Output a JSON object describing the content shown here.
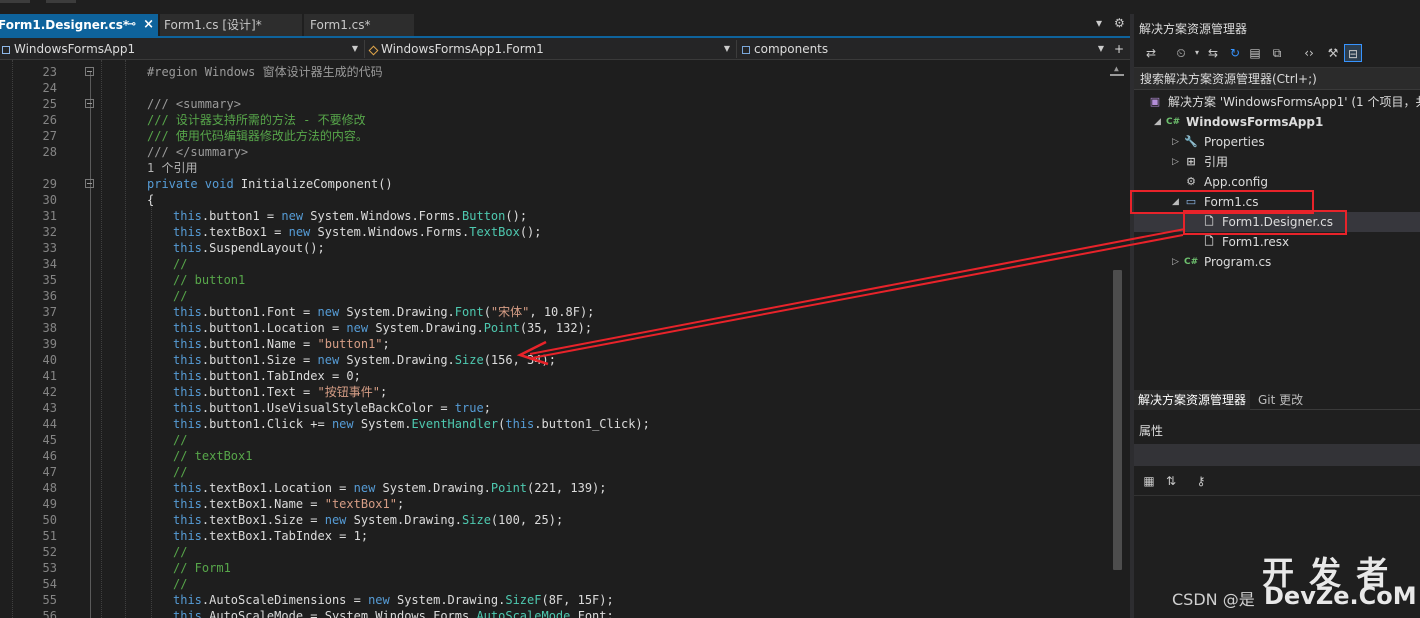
{
  "tabs": [
    {
      "label": "Form1.Designer.cs*",
      "pin": "⊸",
      "close": "×"
    },
    {
      "label": "Form1.cs [设计]*"
    },
    {
      "label": "Form1.cs*"
    }
  ],
  "tab_tools": {
    "overflow": "▾",
    "settings": "⚙"
  },
  "navbar": {
    "project": "WindowsFormsApp1",
    "class": "WindowsFormsApp1.Form1",
    "member": "components"
  },
  "code_lines": [
    {
      "n": "23",
      "fold": true,
      "indent": 0,
      "parts": [
        {
          "c": "g",
          "t": "#region Windows 窗体设计器生成的代码"
        }
      ]
    },
    {
      "n": "24",
      "indent": 0,
      "parts": []
    },
    {
      "n": "25",
      "fold": true,
      "indent": 0,
      "parts": [
        {
          "c": "g",
          "t": "/// <summary>"
        }
      ]
    },
    {
      "n": "26",
      "indent": 0,
      "parts": [
        {
          "c": "cm",
          "t": "/// 设计器支持所需的方法 - 不要修改"
        }
      ]
    },
    {
      "n": "27",
      "indent": 0,
      "parts": [
        {
          "c": "cm",
          "t": "/// 使用代码编辑器修改此方法的内容。"
        }
      ]
    },
    {
      "n": "28",
      "indent": 0,
      "parts": [
        {
          "c": "g",
          "t": "/// </summary>"
        }
      ]
    },
    {
      "n": "",
      "indent": 0,
      "parts": [
        {
          "c": "cr",
          "t": "1 个引用"
        }
      ]
    },
    {
      "n": "29",
      "fold": true,
      "indent": 0,
      "parts": [
        {
          "c": "k",
          "t": "private void "
        },
        {
          "c": "",
          "t": "InitializeComponent()"
        }
      ]
    },
    {
      "n": "30",
      "indent": 0,
      "parts": [
        {
          "c": "",
          "t": "{"
        }
      ]
    },
    {
      "n": "31",
      "indent": 1,
      "parts": [
        {
          "c": "k",
          "t": "this"
        },
        {
          "c": "",
          "t": ".button1 = "
        },
        {
          "c": "k",
          "t": "new "
        },
        {
          "c": "",
          "t": "System.Windows.Forms."
        },
        {
          "c": "t",
          "t": "Button"
        },
        {
          "c": "",
          "t": "();"
        }
      ]
    },
    {
      "n": "32",
      "indent": 1,
      "parts": [
        {
          "c": "k",
          "t": "this"
        },
        {
          "c": "",
          "t": ".textBox1 = "
        },
        {
          "c": "k",
          "t": "new "
        },
        {
          "c": "",
          "t": "System.Windows.Forms."
        },
        {
          "c": "t",
          "t": "TextBox"
        },
        {
          "c": "",
          "t": "();"
        }
      ]
    },
    {
      "n": "33",
      "indent": 1,
      "parts": [
        {
          "c": "k",
          "t": "this"
        },
        {
          "c": "",
          "t": ".SuspendLayout();"
        }
      ]
    },
    {
      "n": "34",
      "indent": 1,
      "parts": [
        {
          "c": "cm",
          "t": "//"
        }
      ]
    },
    {
      "n": "35",
      "indent": 1,
      "parts": [
        {
          "c": "cm",
          "t": "// button1"
        }
      ]
    },
    {
      "n": "36",
      "indent": 1,
      "parts": [
        {
          "c": "cm",
          "t": "//"
        }
      ]
    },
    {
      "n": "37",
      "indent": 1,
      "parts": [
        {
          "c": "k",
          "t": "this"
        },
        {
          "c": "",
          "t": ".button1.Font = "
        },
        {
          "c": "k",
          "t": "new "
        },
        {
          "c": "",
          "t": "System.Drawing."
        },
        {
          "c": "t",
          "t": "Font"
        },
        {
          "c": "",
          "t": "("
        },
        {
          "c": "s",
          "t": "\"宋体\""
        },
        {
          "c": "",
          "t": ", 10.8F);"
        }
      ]
    },
    {
      "n": "38",
      "indent": 1,
      "parts": [
        {
          "c": "k",
          "t": "this"
        },
        {
          "c": "",
          "t": ".button1.Location = "
        },
        {
          "c": "k",
          "t": "new "
        },
        {
          "c": "",
          "t": "System.Drawing."
        },
        {
          "c": "t",
          "t": "Point"
        },
        {
          "c": "",
          "t": "(35, 132);"
        }
      ]
    },
    {
      "n": "39",
      "indent": 1,
      "parts": [
        {
          "c": "k",
          "t": "this"
        },
        {
          "c": "",
          "t": ".button1.Name = "
        },
        {
          "c": "s",
          "t": "\"button1\""
        },
        {
          "c": "",
          "t": ";"
        }
      ]
    },
    {
      "n": "40",
      "indent": 1,
      "parts": [
        {
          "c": "k",
          "t": "this"
        },
        {
          "c": "",
          "t": ".button1.Size = "
        },
        {
          "c": "k",
          "t": "new "
        },
        {
          "c": "",
          "t": "System.Drawing."
        },
        {
          "c": "t",
          "t": "Size"
        },
        {
          "c": "",
          "t": "(156, 34);"
        }
      ]
    },
    {
      "n": "41",
      "indent": 1,
      "parts": [
        {
          "c": "k",
          "t": "this"
        },
        {
          "c": "",
          "t": ".button1.TabIndex = 0;"
        }
      ]
    },
    {
      "n": "42",
      "indent": 1,
      "parts": [
        {
          "c": "k",
          "t": "this"
        },
        {
          "c": "",
          "t": ".button1.Text = "
        },
        {
          "c": "s",
          "t": "\"按钮事件\""
        },
        {
          "c": "",
          "t": ";"
        }
      ]
    },
    {
      "n": "43",
      "indent": 1,
      "parts": [
        {
          "c": "k",
          "t": "this"
        },
        {
          "c": "",
          "t": ".button1.UseVisualStyleBackColor = "
        },
        {
          "c": "k",
          "t": "true"
        },
        {
          "c": "",
          "t": ";"
        }
      ]
    },
    {
      "n": "44",
      "indent": 1,
      "parts": [
        {
          "c": "k",
          "t": "this"
        },
        {
          "c": "",
          "t": ".button1.Click += "
        },
        {
          "c": "k",
          "t": "new "
        },
        {
          "c": "",
          "t": "System."
        },
        {
          "c": "t",
          "t": "EventHandler"
        },
        {
          "c": "",
          "t": "("
        },
        {
          "c": "k",
          "t": "this"
        },
        {
          "c": "",
          "t": ".button1_Click);"
        }
      ]
    },
    {
      "n": "45",
      "indent": 1,
      "parts": [
        {
          "c": "cm",
          "t": "//"
        }
      ]
    },
    {
      "n": "46",
      "indent": 1,
      "parts": [
        {
          "c": "cm",
          "t": "// textBox1"
        }
      ]
    },
    {
      "n": "47",
      "indent": 1,
      "parts": [
        {
          "c": "cm",
          "t": "//"
        }
      ]
    },
    {
      "n": "48",
      "indent": 1,
      "parts": [
        {
          "c": "k",
          "t": "this"
        },
        {
          "c": "",
          "t": ".textBox1.Location = "
        },
        {
          "c": "k",
          "t": "new "
        },
        {
          "c": "",
          "t": "System.Drawing."
        },
        {
          "c": "t",
          "t": "Point"
        },
        {
          "c": "",
          "t": "(221, 139);"
        }
      ]
    },
    {
      "n": "49",
      "indent": 1,
      "parts": [
        {
          "c": "k",
          "t": "this"
        },
        {
          "c": "",
          "t": ".textBox1.Name = "
        },
        {
          "c": "s",
          "t": "\"textBox1\""
        },
        {
          "c": "",
          "t": ";"
        }
      ]
    },
    {
      "n": "50",
      "indent": 1,
      "parts": [
        {
          "c": "k",
          "t": "this"
        },
        {
          "c": "",
          "t": ".textBox1.Size = "
        },
        {
          "c": "k",
          "t": "new "
        },
        {
          "c": "",
          "t": "System.Drawing."
        },
        {
          "c": "t",
          "t": "Size"
        },
        {
          "c": "",
          "t": "(100, 25);"
        }
      ]
    },
    {
      "n": "51",
      "indent": 1,
      "parts": [
        {
          "c": "k",
          "t": "this"
        },
        {
          "c": "",
          "t": ".textBox1.TabIndex = 1;"
        }
      ]
    },
    {
      "n": "52",
      "indent": 1,
      "parts": [
        {
          "c": "cm",
          "t": "//"
        }
      ]
    },
    {
      "n": "53",
      "indent": 1,
      "parts": [
        {
          "c": "cm",
          "t": "// Form1"
        }
      ]
    },
    {
      "n": "54",
      "indent": 1,
      "parts": [
        {
          "c": "cm",
          "t": "//"
        }
      ]
    },
    {
      "n": "55",
      "indent": 1,
      "parts": [
        {
          "c": "k",
          "t": "this"
        },
        {
          "c": "",
          "t": ".AutoScaleDimensions = "
        },
        {
          "c": "k",
          "t": "new "
        },
        {
          "c": "",
          "t": "System.Drawing."
        },
        {
          "c": "t",
          "t": "SizeF"
        },
        {
          "c": "",
          "t": "(8F, 15F);"
        }
      ]
    },
    {
      "n": "56",
      "indent": 1,
      "parts": [
        {
          "c": "k",
          "t": "this"
        },
        {
          "c": "",
          "t": ".AutoScaleMode = System.Windows.Forms."
        },
        {
          "c": "t",
          "t": "AutoScaleMode"
        },
        {
          "c": "",
          "t": ".Font;"
        }
      ]
    }
  ],
  "solution_explorer": {
    "title": "解决方案资源管理器",
    "search_placeholder": "搜索解决方案资源管理器(Ctrl+;)",
    "tree": [
      {
        "label": "解决方案 'WindowsFormsApp1' (1 个项目，共",
        "icon": "solution-icon",
        "depth": 0,
        "expander": "",
        "bold": false
      },
      {
        "label": "WindowsFormsApp1",
        "icon": "csharp-project-icon",
        "depth": 1,
        "expander": "◢",
        "bold": true
      },
      {
        "label": "Properties",
        "icon": "wrench-icon",
        "depth": 2,
        "expander": "▷",
        "bold": false
      },
      {
        "label": "引用",
        "icon": "references-icon",
        "depth": 2,
        "expander": "▷",
        "bold": false
      },
      {
        "label": "App.config",
        "icon": "config-file-icon",
        "depth": 2,
        "expander": "",
        "bold": false
      },
      {
        "label": "Form1.cs",
        "icon": "form-icon",
        "depth": 2,
        "expander": "◢",
        "bold": false
      },
      {
        "label": "Form1.Designer.cs",
        "icon": "file-icon",
        "depth": 3,
        "expander": "",
        "bold": false,
        "selected": true
      },
      {
        "label": "Form1.resx",
        "icon": "file-icon",
        "depth": 3,
        "expander": "",
        "bold": false
      },
      {
        "label": "Program.cs",
        "icon": "csharp-file-icon",
        "depth": 2,
        "expander": "▷",
        "bold": false
      }
    ],
    "bottom_tabs": [
      "解决方案资源管理器",
      "Git 更改"
    ]
  },
  "properties": {
    "title": "属性"
  },
  "watermark": {
    "csdn": "CSDN @是",
    "brand_cn": "开 发 者",
    "brand_en": "DevZe.CoM"
  },
  "colors": {
    "accent": "#0e639c",
    "annotation": "#e8232a",
    "keyword": "#569cd6",
    "type": "#4ec9b0",
    "string": "#d69d85",
    "comment": "#57a64a"
  }
}
